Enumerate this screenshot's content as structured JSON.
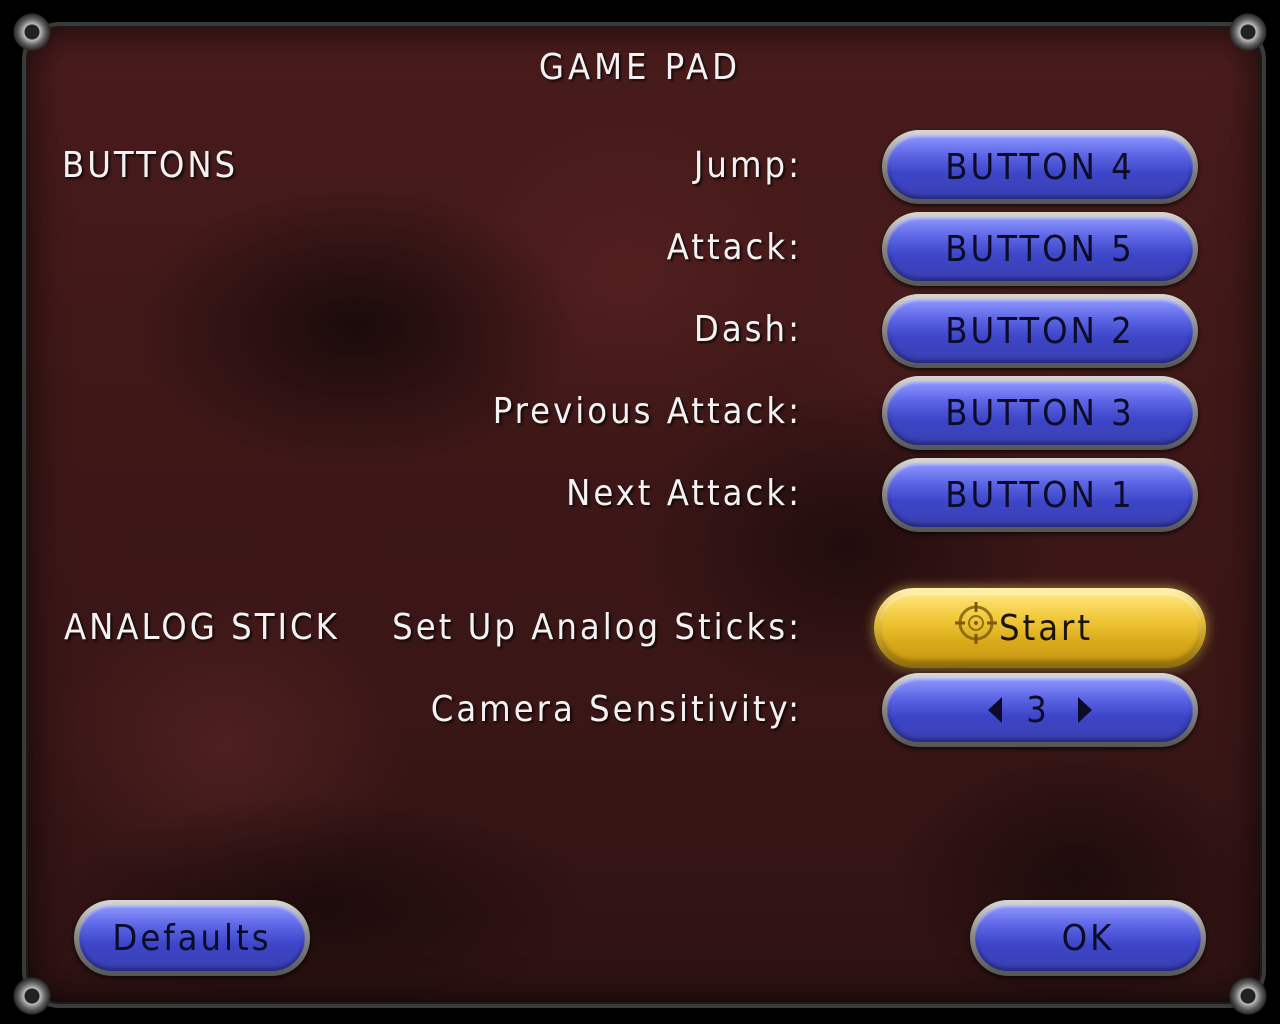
{
  "title": "GAME PAD",
  "sections": {
    "buttons": "BUTTONS",
    "analog": "ANALOG STICK"
  },
  "bindings": [
    {
      "label": "Jump:",
      "value": "BUTTON 4"
    },
    {
      "label": "Attack:",
      "value": "BUTTON 5"
    },
    {
      "label": "Dash:",
      "value": "BUTTON 2"
    },
    {
      "label": "Previous Attack:",
      "value": "BUTTON 3"
    },
    {
      "label": "Next Attack:",
      "value": "BUTTON 1"
    }
  ],
  "analog": {
    "setup_label": "Set Up Analog Sticks:",
    "setup_button": "Start",
    "sensitivity_label": "Camera Sensitivity:",
    "sensitivity_value": "3"
  },
  "footer": {
    "defaults": "Defaults",
    "ok": "OK"
  },
  "colors": {
    "background": "#3e1717",
    "button_blue": "#5e67e6",
    "button_gold": "#f2c93a",
    "text": "#f2f2f2"
  },
  "icons": {
    "cursor": "crosshair-cursor-icon",
    "decrease": "arrow-left-icon",
    "increase": "arrow-right-icon",
    "corners": "metal-bolt-icon"
  }
}
